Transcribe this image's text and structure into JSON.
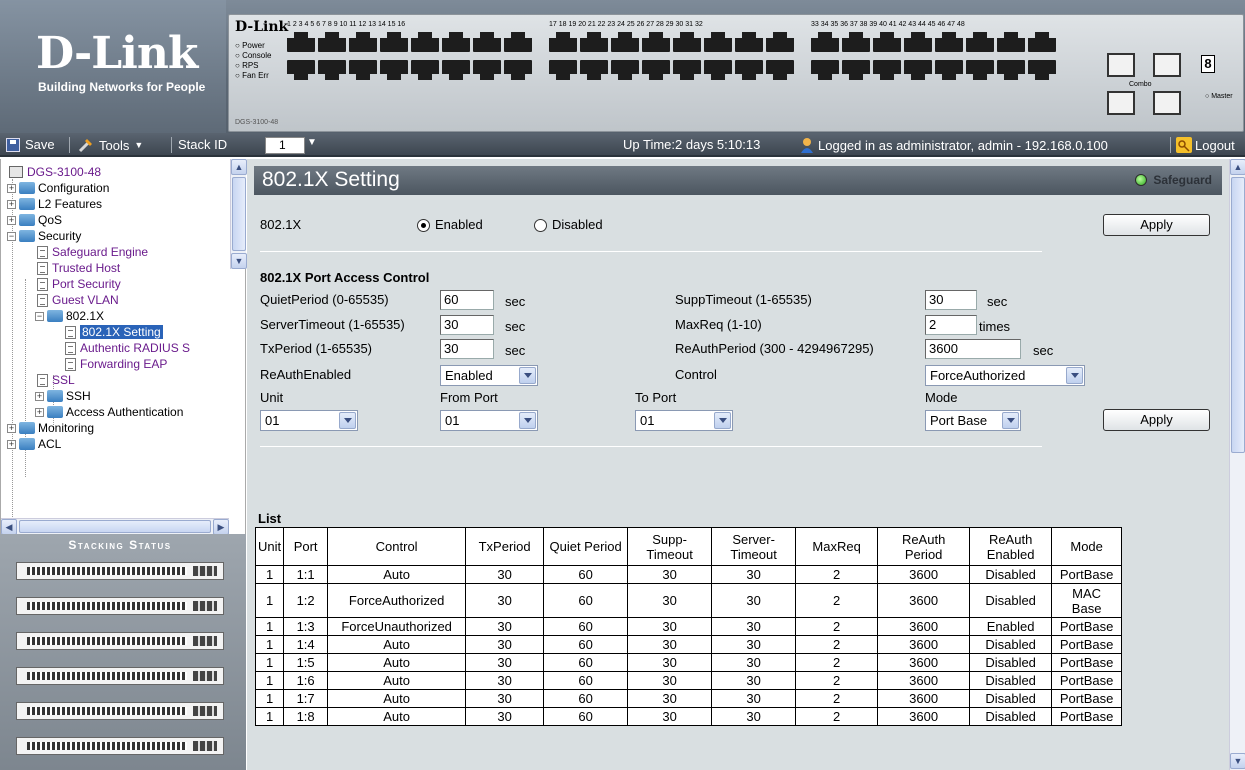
{
  "brand": {
    "logo": "D-Link",
    "tagline": "Building Networks for People"
  },
  "device": {
    "brand": "D-Link",
    "leds": [
      "Power",
      "Console",
      "RPS",
      "Fan Err"
    ],
    "model": "DGS-3100-48",
    "port_numbers_1": "1 2 3 4 5 6 7 8 9 10 11 12 13 14 15 16",
    "port_numbers_2": "17 18 19 20 21 22 23 24 25 26 27 28 29 30 31 32",
    "port_numbers_3": "33 34 35 36 37 38 39 40 41 42 43 44 45 46 47 48",
    "combo_label": "Combo",
    "master_label": "Master",
    "display_digit": "8"
  },
  "toolbar": {
    "save": "Save",
    "tools": "Tools",
    "stack_id_label": "Stack ID",
    "stack_id_value": "1",
    "status": "Up Time:2 days 5:10:13",
    "login": "Logged in as administrator, admin - 192.168.0.100",
    "logout": "Logout"
  },
  "tree": {
    "root": "DGS-3100-48",
    "configuration": "Configuration",
    "l2": "L2 Features",
    "qos": "QoS",
    "security": "Security",
    "safeguard": "Safeguard Engine",
    "trusted": "Trusted Host",
    "port_security": "Port Security",
    "guest_vlan": "Guest VLAN",
    "dot1x": "802.1X",
    "dot1x_setting": "802.1X Setting",
    "radius": "Authentic RADIUS S",
    "forwarding": "Forwarding EAP",
    "ssl": "SSL",
    "ssh": "SSH",
    "access_auth": "Access Authentication",
    "monitoring": "Monitoring",
    "acl": "ACL"
  },
  "stacking": {
    "title": "Stacking Status"
  },
  "page": {
    "title": "802.1X Setting",
    "safeguard": "Safeguard",
    "dot1x_label": "802.1X",
    "enabled": "Enabled",
    "disabled": "Disabled",
    "apply": "Apply",
    "section": "802.1X Port Access Control",
    "quiet_label": "QuietPeriod (0-65535)",
    "quiet_value": "60",
    "server_label": "ServerTimeout (1-65535)",
    "server_value": "30",
    "tx_label": "TxPeriod (1-65535)",
    "tx_value": "30",
    "supp_label": "SuppTimeout (1-65535)",
    "supp_value": "30",
    "maxreq_label": "MaxReq (1-10)",
    "maxreq_value": "2",
    "reauthp_label": "ReAuthPeriod (300 - 4294967295)",
    "reauthp_value": "3600",
    "sec": "sec",
    "times": "times",
    "reauth_enabled_label": "ReAuthEnabled",
    "reauth_enabled_value": "Enabled",
    "control_label": "Control",
    "control_value": "ForceAuthorized",
    "unit_label": "Unit",
    "unit_value": "01",
    "from_label": "From Port",
    "from_value": "01",
    "to_label": "To Port",
    "to_value": "01",
    "mode_label": "Mode",
    "mode_value": "Port Base",
    "apply2": "Apply",
    "list_label": "List"
  },
  "table": {
    "headers": [
      "Unit",
      "Port",
      "Control",
      "TxPeriod",
      "Quiet Period",
      "Supp-\nTimeout",
      "Server-\nTimeout",
      "MaxReq",
      "ReAuth\nPeriod",
      "ReAuth\nEnabled",
      "Mode"
    ],
    "rows": [
      [
        "1",
        "1:1",
        "Auto",
        "30",
        "60",
        "30",
        "30",
        "2",
        "3600",
        "Disabled",
        "PortBase"
      ],
      [
        "1",
        "1:2",
        "ForceAuthorized",
        "30",
        "60",
        "30",
        "30",
        "2",
        "3600",
        "Disabled",
        "MAC\nBase"
      ],
      [
        "1",
        "1:3",
        "ForceUnauthorized",
        "30",
        "60",
        "30",
        "30",
        "2",
        "3600",
        "Enabled",
        "PortBase"
      ],
      [
        "1",
        "1:4",
        "Auto",
        "30",
        "60",
        "30",
        "30",
        "2",
        "3600",
        "Disabled",
        "PortBase"
      ],
      [
        "1",
        "1:5",
        "Auto",
        "30",
        "60",
        "30",
        "30",
        "2",
        "3600",
        "Disabled",
        "PortBase"
      ],
      [
        "1",
        "1:6",
        "Auto",
        "30",
        "60",
        "30",
        "30",
        "2",
        "3600",
        "Disabled",
        "PortBase"
      ],
      [
        "1",
        "1:7",
        "Auto",
        "30",
        "60",
        "30",
        "30",
        "2",
        "3600",
        "Disabled",
        "PortBase"
      ],
      [
        "1",
        "1:8",
        "Auto",
        "30",
        "60",
        "30",
        "30",
        "2",
        "3600",
        "Disabled",
        "PortBase"
      ]
    ]
  }
}
